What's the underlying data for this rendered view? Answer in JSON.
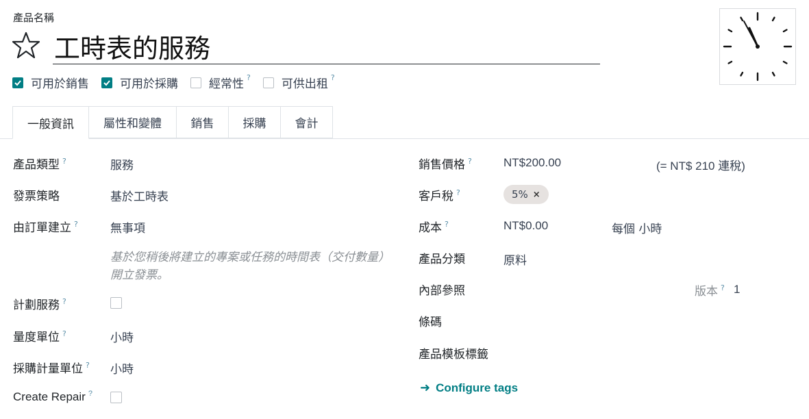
{
  "header": {
    "product_name_label": "產品名稱",
    "title": "工時表的服務",
    "checkboxes": [
      {
        "label": "可用於銷售",
        "checked": true,
        "help": ""
      },
      {
        "label": "可用於採購",
        "checked": true,
        "help": ""
      },
      {
        "label": "經常性",
        "checked": false,
        "help": "?"
      },
      {
        "label": "可供出租",
        "checked": false,
        "help": "?"
      }
    ]
  },
  "tabs": [
    "一般資訊",
    "屬性和變體",
    "銷售",
    "採購",
    "會計"
  ],
  "left": {
    "product_type": {
      "label": "產品類型",
      "help": "?",
      "value": "服務"
    },
    "invoice_policy": {
      "label": "發票策略",
      "value": "基於工時表"
    },
    "create_on_order": {
      "label": "由訂單建立",
      "help": "?",
      "value": "無事項"
    },
    "note": "基於您稍後將建立的專案或任務的時間表（交付數量）開立發票。",
    "plan_services": {
      "label": "計劃服務",
      "help": "?",
      "checked": false
    },
    "uom": {
      "label": "量度單位",
      "help": "?",
      "value": "小時"
    },
    "purchase_uom": {
      "label": "採購計量單位",
      "help": "?",
      "value": "小時"
    },
    "create_repair": {
      "label": "Create Repair",
      "help": "?",
      "checked": false
    }
  },
  "right": {
    "sales_price": {
      "label": "銷售價格",
      "help": "?",
      "value": "NT$200.00",
      "tax_incl": "(= NT$ 210 連稅)"
    },
    "customer_tax": {
      "label": "客戶稅",
      "help": "?",
      "tag": "5%",
      "tag_remove": "×"
    },
    "cost": {
      "label": "成本",
      "help": "?",
      "value": "NT$0.00",
      "per": "每個 小時"
    },
    "category": {
      "label": "產品分類",
      "value": "原料"
    },
    "internal_ref": {
      "label": "內部參照"
    },
    "version": {
      "label": "版本",
      "help": "?",
      "value": "1"
    },
    "barcode": {
      "label": "條碼"
    },
    "template_tags": {
      "label": "產品模板標籤"
    },
    "configure_tags": "Configure tags"
  },
  "colors": {
    "accent": "#017e84",
    "tag_bg": "#e6e2e0"
  }
}
